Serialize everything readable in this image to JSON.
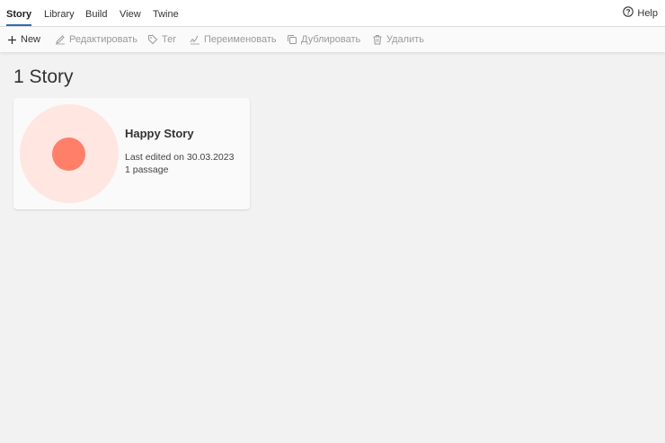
{
  "tabs": [
    {
      "label": "Story",
      "active": true
    },
    {
      "label": "Library",
      "active": false
    },
    {
      "label": "Build",
      "active": false
    },
    {
      "label": "View",
      "active": false
    },
    {
      "label": "Twine",
      "active": false
    }
  ],
  "help": {
    "label": "Help",
    "icon": "help-circle-icon"
  },
  "toolbar": {
    "new": {
      "label": "New",
      "icon": "plus-icon",
      "enabled": true
    },
    "edit": {
      "label": "Редактировать",
      "icon": "pencil-icon",
      "enabled": false
    },
    "tag": {
      "label": "Тег",
      "icon": "tag-icon",
      "enabled": false
    },
    "rename": {
      "label": "Переименовать",
      "icon": "signature-icon",
      "enabled": false
    },
    "duplicate": {
      "label": "Дублировать",
      "icon": "copy-icon",
      "enabled": false
    },
    "delete": {
      "label": "Удалить",
      "icon": "trash-icon",
      "enabled": false
    }
  },
  "main": {
    "heading": "1 Story",
    "stories": [
      {
        "name": "Happy Story",
        "last_edited": "Last edited on 30.03.2023",
        "passages": "1 passage"
      }
    ]
  },
  "colors": {
    "active_tab_underline": "#2b6cb0",
    "preview_bg": "#ffe6e1",
    "preview_dot": "#ff7f69",
    "disabled_text": "#9a9a9a"
  }
}
